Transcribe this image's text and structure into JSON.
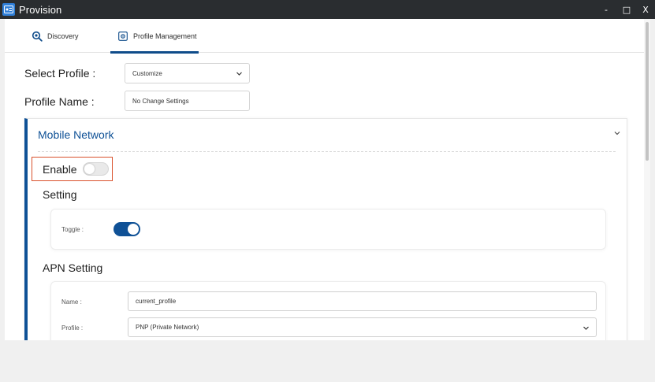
{
  "window": {
    "title": "Provision",
    "minimize": "-",
    "maximize": "□",
    "close": "X"
  },
  "tabs": [
    {
      "label": "Discovery",
      "icon": "discovery-search-icon",
      "active": false
    },
    {
      "label": "Profile Management",
      "icon": "gear-icon",
      "active": true
    }
  ],
  "form": {
    "select_profile_label": "Select Profile :",
    "select_profile_value": "Customize",
    "profile_name_label": "Profile Name :",
    "profile_name_value": "No Change Settings"
  },
  "mobile_network": {
    "title": "Mobile Network",
    "enable_label": "Enable",
    "enable_on": false,
    "setting_title": "Setting",
    "toggle_label": "Toggle :",
    "toggle_on": true,
    "apn_title": "APN Setting",
    "apn_name_label": "Name :",
    "apn_name_value": "current_profile",
    "apn_profile_label": "Profile :",
    "apn_profile_value": "PNP (Private Network)"
  },
  "colors": {
    "accent": "#0f5196",
    "highlight": "#d9512c",
    "titlebar": "#2a2d30"
  }
}
